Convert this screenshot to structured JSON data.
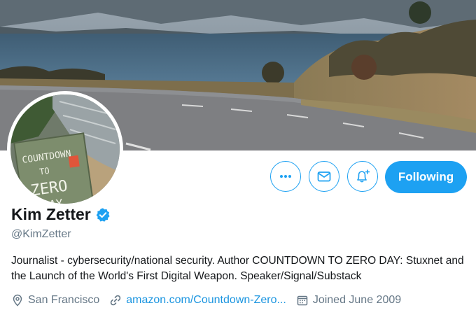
{
  "profile": {
    "name": "Kim Zetter",
    "handle": "@KimZetter",
    "verified": true,
    "bio": "Journalist - cybersecurity/national security. Author COUNTDOWN TO ZERO DAY: Stuxnet and the Launch of the World's First Digital Weapon. Speaker/Signal/Substack",
    "location": "San Francisco",
    "website": "amazon.com/Countdown-Zero...",
    "joined": "Joined June 2009"
  },
  "avatar": {
    "book_lines": [
      "COUNTDOWN",
      "TO",
      "ZERO",
      "DAY"
    ]
  },
  "actions": {
    "more_icon": "more-dots-icon",
    "message_icon": "envelope-icon",
    "notify_icon": "bell-plus-icon",
    "follow_label": "Following"
  },
  "colors": {
    "accent": "#1da1f2",
    "link": "#1b95e0",
    "secondary_text": "#657786",
    "primary_text": "#14171a"
  }
}
